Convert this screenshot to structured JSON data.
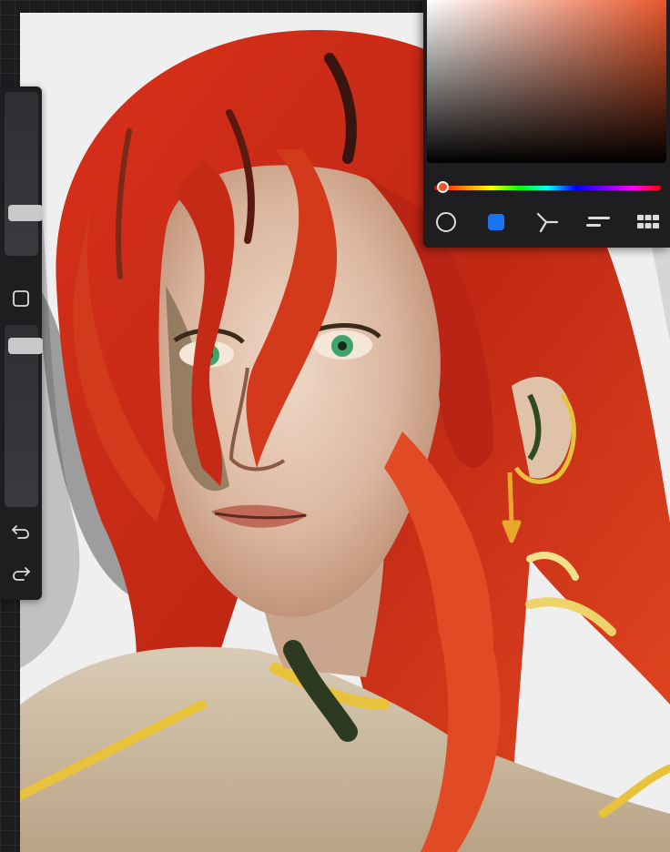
{
  "colors": {
    "hue": "#e8572a",
    "swatch": "#1a74f2",
    "panel": "#1e1e20",
    "icon": "#dcdcde"
  },
  "color_panel": {
    "hue_value": 0.04,
    "tools": [
      {
        "name": "disc-mode",
        "icon": "circle-icon"
      },
      {
        "name": "current-color",
        "icon": "blue-square-swatch"
      },
      {
        "name": "harmony-mode",
        "icon": "harmony-icon"
      },
      {
        "name": "value-sliders",
        "icon": "sliders-icon"
      },
      {
        "name": "palettes",
        "icon": "grid-icon"
      }
    ]
  },
  "sidebar": {
    "brush_size_level": 0.83,
    "opacity_level": 0.86,
    "modify_icon": "square-outline-icon",
    "undo_icon": "undo-icon",
    "redo_icon": "redo-icon"
  },
  "artwork": {
    "subject": "painted-portrait"
  }
}
